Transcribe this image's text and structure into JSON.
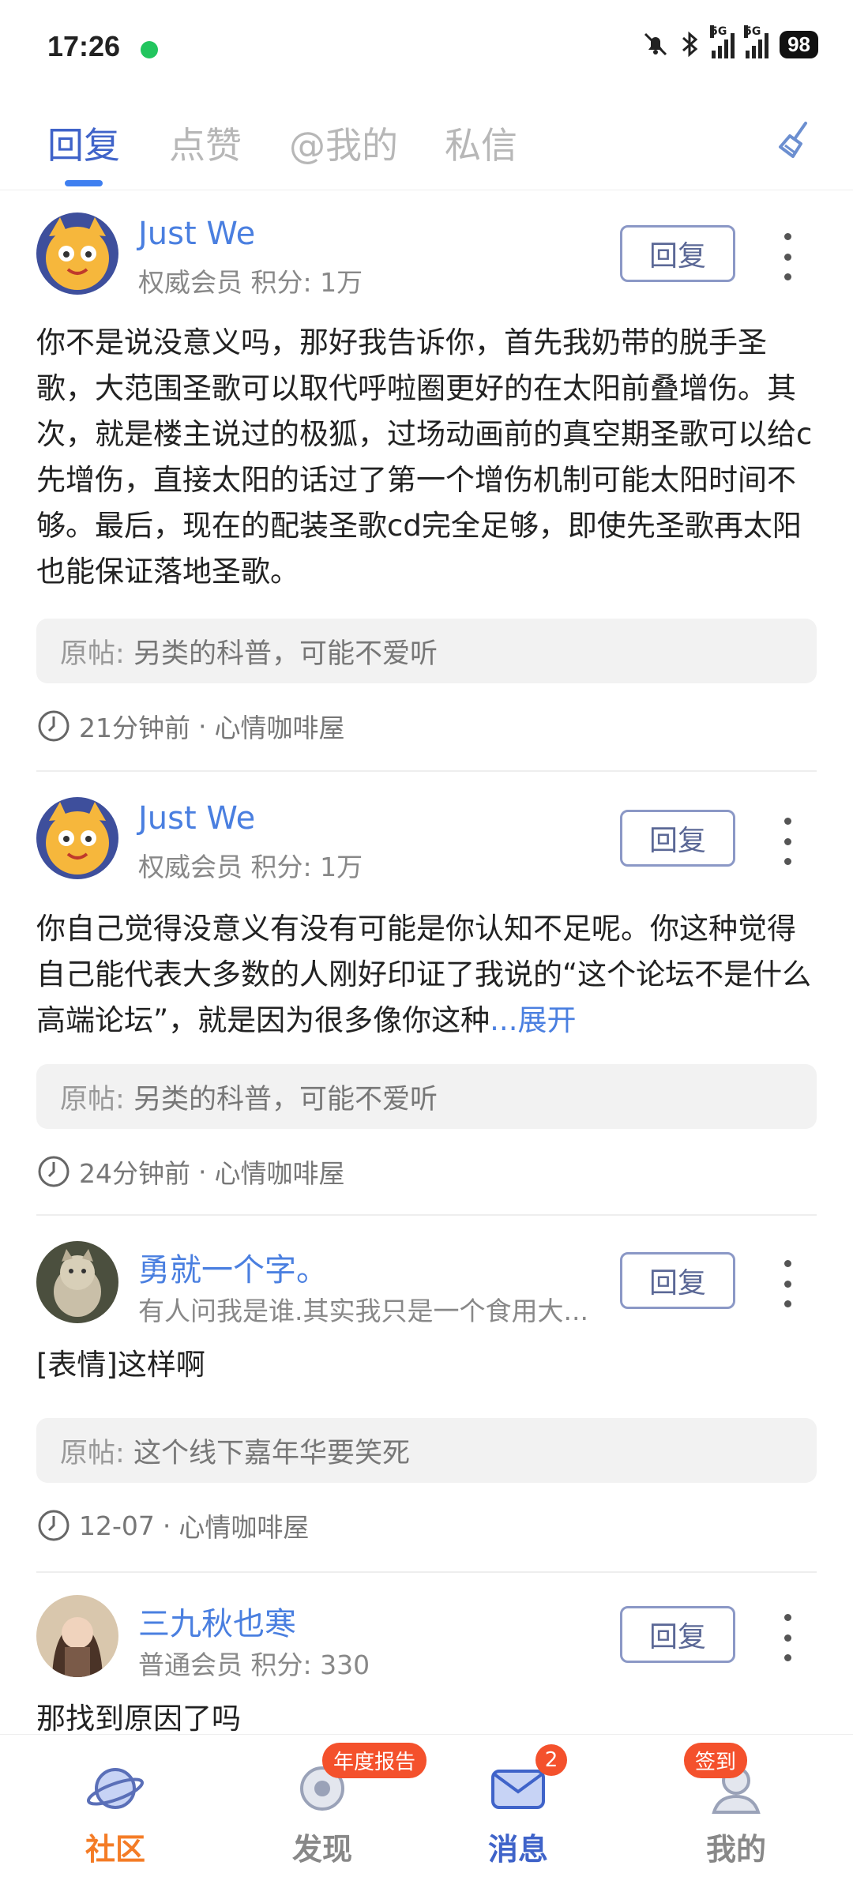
{
  "status": {
    "time": "17:26",
    "battery": "98",
    "net1": "5G",
    "net2": "5G"
  },
  "tabs": [
    "回复",
    "点赞",
    "@我的",
    "私信"
  ],
  "reply_label": "回复",
  "orig_label": "原帖:",
  "items": [
    {
      "user": "Just We",
      "meta": "权威会员  积分: 1万",
      "content": "你不是说没意义吗，那好我告诉你，首先我奶带的脱手圣歌，大范围圣歌可以取代呼啦圈更好的在太阳前叠增伤。其次，就是楼主说过的极狐，过场动画前的真空期圣歌可以给c先增伤，直接太阳的话过了第一个增伤机制可能太阳时间不够。最后，现在的配装圣歌cd完全足够，即使先圣歌再太阳也能保证落地圣歌。",
      "orig": "另类的科普，可能不爱听",
      "time": "21分钟前",
      "forum": "心情咖啡屋"
    },
    {
      "user": "Just We",
      "meta": "权威会员  积分: 1万",
      "content": "你自己觉得没意义有没有可能是你认知不足呢。你这种觉得自己能代表大多数的人刚好印证了我说的“这个论坛不是什么高端论坛”，就是因为很多像你这种",
      "expand": "...展开",
      "orig": "另类的科普，可能不爱听",
      "time": "24分钟前",
      "forum": "心情咖啡屋"
    },
    {
      "user": "勇就一个字。",
      "meta": "有人问我是谁.其实我只是一个食用大...",
      "content": "[表情]这样啊",
      "orig": "这个线下嘉年华要笑死",
      "time": "12-07",
      "forum": "心情咖啡屋"
    },
    {
      "user": "三九秋也寒",
      "meta": "普通会员  积分: 330",
      "content": "那找到原因了吗"
    }
  ],
  "bottom_nav": [
    {
      "label": "社区"
    },
    {
      "label": "发现",
      "pill": "年度报告"
    },
    {
      "label": "消息",
      "badge": "2"
    },
    {
      "label": "我的",
      "pill": "签到"
    }
  ],
  "colors": {
    "accent": "#3f63c9",
    "active_nav": "#f47c26",
    "badge": "#f4512c"
  }
}
